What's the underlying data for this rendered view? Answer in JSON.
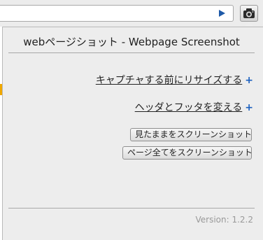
{
  "browser": {
    "go_icon": "play-triangle-icon",
    "extension_icon": "camera-icon"
  },
  "popup": {
    "title": "webページショット - Webpage Screenshot",
    "link_resize": "キャプチャする前にリサイズする",
    "link_resize_plus": "+",
    "link_header_footer": "ヘッダとフッタを変える",
    "link_header_footer_plus": "+",
    "button_visible": "見たままをスクリーンショット",
    "button_full": "ページ全てをスクリーンショット",
    "version": "Version: 1.2.2"
  },
  "colors": {
    "plus": "#1a5fbf",
    "accent": "#f0a800",
    "go_icon": "#1e5aa8"
  }
}
